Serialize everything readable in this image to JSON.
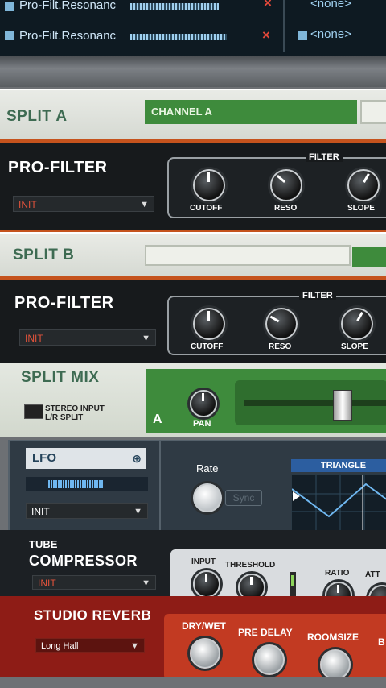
{
  "mapping": {
    "rows": [
      {
        "param": "Pro-Filt.Resonanc",
        "target": "<none>"
      },
      {
        "param": "Pro-Filt.Resonanc",
        "target": "<none>"
      }
    ],
    "remove_symbol": "×"
  },
  "split_a": {
    "title": "SPLIT A",
    "channel": "CHANNEL A"
  },
  "pro_filter_1": {
    "title": "PRO-FILTER",
    "preset": "INIT",
    "section": "FILTER",
    "knobs": [
      "CUTOFF",
      "RESO",
      "SLOPE"
    ]
  },
  "split_b": {
    "title": "SPLIT B"
  },
  "pro_filter_2": {
    "title": "PRO-FILTER",
    "preset": "INIT",
    "section": "FILTER",
    "knobs": [
      "CUTOFF",
      "RESO",
      "SLOPE"
    ]
  },
  "split_mix": {
    "title": "SPLIT MIX",
    "stereo_label": "STEREO INPUT L/R SPLIT",
    "channel": "A",
    "pan": "PAN"
  },
  "lfo": {
    "title": "LFO",
    "preset": "INIT",
    "rate": "Rate",
    "sync": "Sync",
    "waveform": "TRIANGLE"
  },
  "compressor": {
    "title_line1": "TUBE",
    "title_line2": "COMPRESSOR",
    "preset": "INIT",
    "labels": [
      "INPUT",
      "THRESHOLD",
      "RATIO",
      "ATT"
    ]
  },
  "reverb": {
    "title": "STUDIO REVERB",
    "preset": "Long Hall",
    "labels": [
      "DRY/WET",
      "PRE DELAY",
      "ROOMSIZE",
      "B"
    ]
  },
  "colors": {
    "accent_orange": "#c5531d",
    "green": "#3e8b3c",
    "reverb_red": "#c23a22"
  }
}
